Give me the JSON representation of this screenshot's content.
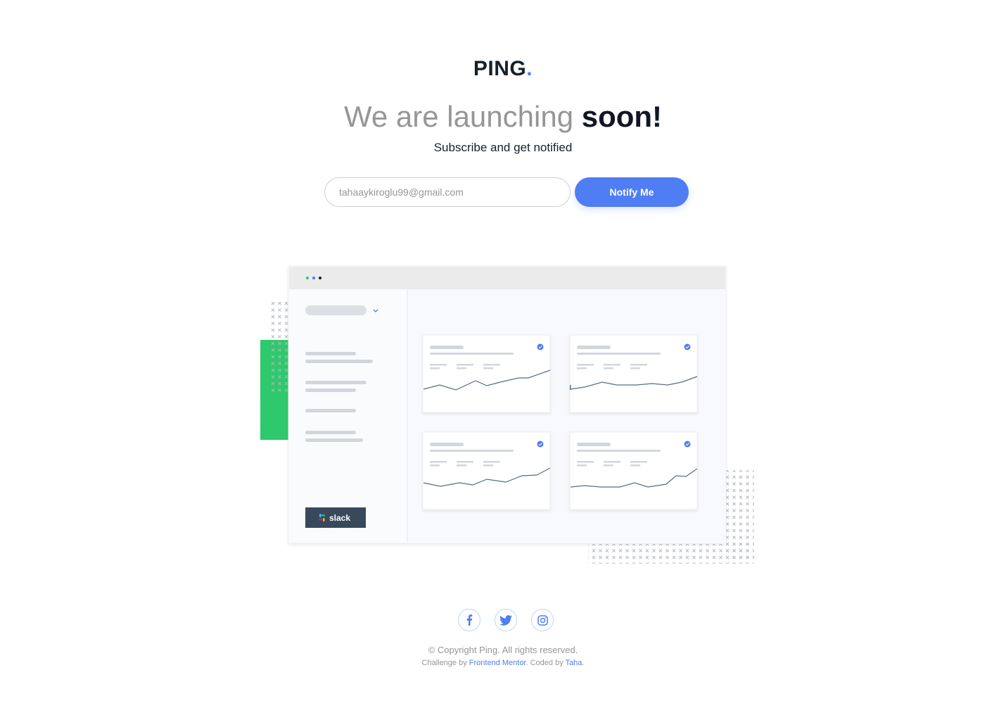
{
  "logo": {
    "text": "PING",
    "dot": "."
  },
  "headline": {
    "light": "We are launching ",
    "strong": "soon!"
  },
  "subtitle": "Subscribe and get notified",
  "form": {
    "email_value": "tahaaykiroglu99@gmail.com",
    "button_label": "Notify Me"
  },
  "dashboard": {
    "slack_label": "slack"
  },
  "social": {
    "items": [
      {
        "icon": "facebook-icon"
      },
      {
        "icon": "twitter-icon"
      },
      {
        "icon": "instagram-icon"
      }
    ]
  },
  "footer": {
    "copyright": "© Copyright Ping. All rights reserved.",
    "challenge_prefix": "Challenge by ",
    "challenge_link": "Frontend Mentor",
    "coded_prefix": ". Coded by ",
    "coded_link": "Taha",
    "coded_suffix": "."
  },
  "colors": {
    "accent": "#4f7df3",
    "dark": "#121725",
    "gray": "#969696",
    "green": "#2ec96c"
  }
}
